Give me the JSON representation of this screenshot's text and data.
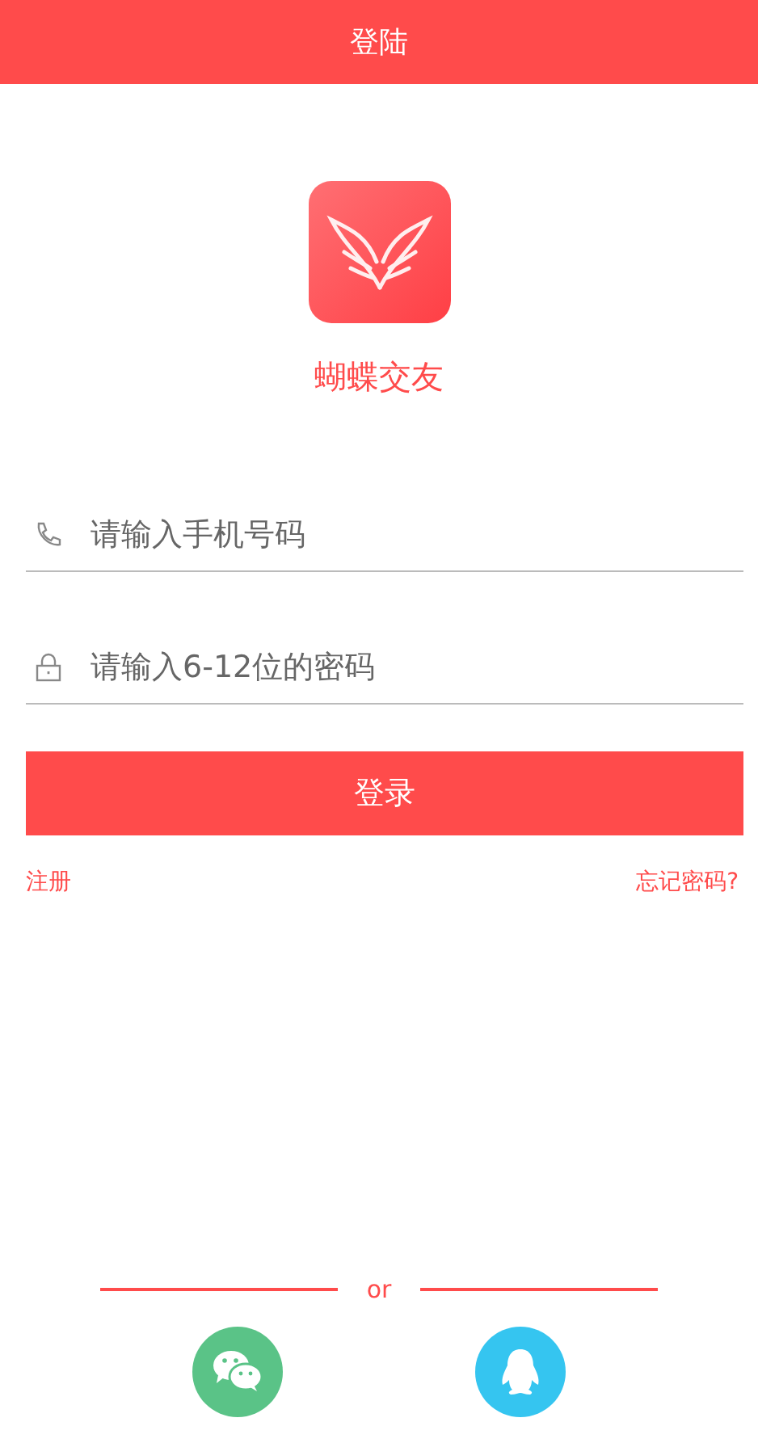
{
  "header": {
    "title": "登陆"
  },
  "app": {
    "name": "蝴蝶交友"
  },
  "fields": [
    {
      "kind": "phone",
      "placeholder": "请输入手机号码"
    },
    {
      "kind": "password",
      "placeholder": "请输入6-12位的密码"
    }
  ],
  "login_button": "登录",
  "links": {
    "register": "注册",
    "forgot": "忘记密码?"
  },
  "divider": "or",
  "social": [
    {
      "kind": "wechat",
      "color": "#5ac387"
    },
    {
      "kind": "qq",
      "color": "#35c5f0"
    }
  ]
}
